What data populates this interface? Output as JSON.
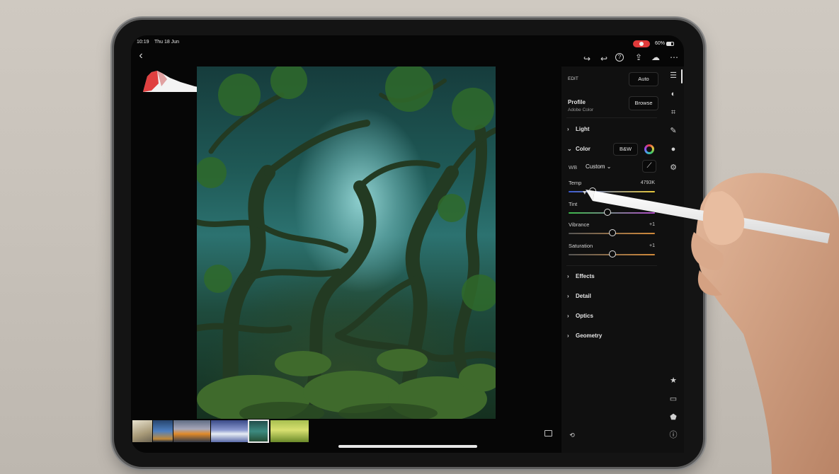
{
  "status_bar": {
    "time": "10:19",
    "date": "Thu 18 Jun",
    "battery": "60%"
  },
  "top_bar": {
    "back_icon": "back-chevron-icon",
    "icons": [
      "redo-icon",
      "undo-icon",
      "help-icon",
      "share-icon",
      "cloud-sync-icon",
      "more-icon"
    ]
  },
  "edit_panel": {
    "edit_label": "EDIT",
    "auto_button": "Auto",
    "profile_label": "Profile",
    "profile_value": "Adobe Color",
    "browse_button": "Browse",
    "sections": {
      "light": "Light",
      "color": "Color",
      "effects": "Effects",
      "detail": "Detail",
      "optics": "Optics",
      "geometry": "Geometry"
    },
    "bw_button": "B&W",
    "wb_label": "WB",
    "wb_value": "Custom",
    "sliders": [
      {
        "label": "Temp",
        "value": "4793K",
        "level": 0.28,
        "gradient": [
          "#3b5bd6",
          "#e8c93b"
        ]
      },
      {
        "label": "Tint",
        "value": "",
        "level": 0.45,
        "gradient": [
          "#3cba4a",
          "#b04ac8"
        ]
      },
      {
        "label": "Vibrance",
        "value": "+1",
        "level": 0.51,
        "gradient": [
          "#555555",
          "#d28a3a"
        ]
      },
      {
        "label": "Saturation",
        "value": "+1",
        "level": 0.51,
        "gradient": [
          "#555555",
          "#d28a3a"
        ]
      }
    ]
  },
  "tool_strip": {
    "top_icons": [
      "sliders-icon",
      "selective-icon",
      "crop-icon",
      "brush-icon",
      "mask-icon",
      "presets-icon"
    ],
    "bottom_icons": [
      "star-icon",
      "comment-icon",
      "tag-icon",
      "info-icon"
    ]
  },
  "filmstrip": {
    "selected_index": 4,
    "count": 6
  },
  "colors": {
    "recording_badge": "#e03a3a",
    "panel_bg": "#101010",
    "screen_bg": "#060606"
  }
}
